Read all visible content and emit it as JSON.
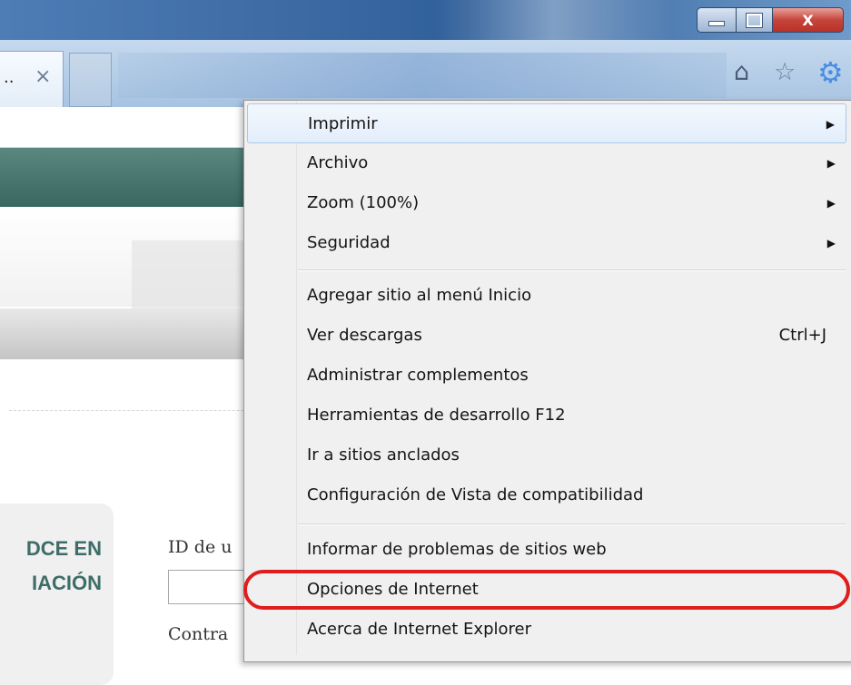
{
  "window": {
    "caption": {
      "minimize_icon": "minimize-icon",
      "maximize_icon": "restore-icon",
      "close_icon": "close-icon",
      "close_glyph": "X"
    }
  },
  "tabbar": {
    "tab_label": "..",
    "tab_close": "×",
    "icons": {
      "home": "⌂",
      "favorites": "☆",
      "tools": "⚙"
    }
  },
  "page": {
    "login_title_line1": "DCE EN",
    "login_title_line2": "IACIÓN",
    "id_label": "ID de u",
    "password_label": "Contra"
  },
  "menu": {
    "items": [
      {
        "label": "Imprimir",
        "submenu": true
      },
      {
        "label": "Archivo",
        "submenu": true
      },
      {
        "label": "Zoom (100%)",
        "submenu": true
      },
      {
        "label": "Seguridad",
        "submenu": true
      },
      {
        "label": "Agregar sitio al menú Inicio"
      },
      {
        "label": "Ver descargas",
        "shortcut": "Ctrl+J"
      },
      {
        "label": "Administrar complementos"
      },
      {
        "label": "Herramientas de desarrollo F12"
      },
      {
        "label": "Ir a sitios anclados"
      },
      {
        "label": "Configuración de Vista de compatibilidad"
      },
      {
        "label": "Informar de problemas de sitios web"
      },
      {
        "label": "Opciones de Internet",
        "highlighted": true
      },
      {
        "label": "Acerca de Internet Explorer"
      }
    ],
    "arrow_glyph": "▶"
  },
  "colors": {
    "highlight_ring": "#e01d1d",
    "page_header": "#3b6761",
    "menu_bg": "#f0f0f0"
  }
}
